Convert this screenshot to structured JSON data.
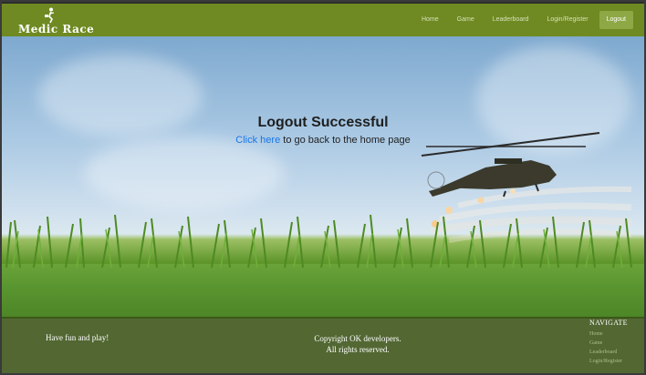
{
  "navbar": {
    "logo_text": "Medic Race",
    "links": [
      {
        "label": "Home"
      },
      {
        "label": "Game"
      },
      {
        "label": "Leaderboard"
      },
      {
        "label": "Login/Register"
      },
      {
        "label": "Logout"
      }
    ],
    "active_index": 4,
    "color": "#6f8a22"
  },
  "hero": {
    "title": "Logout Successful",
    "link_text": "Click here",
    "rest_text": " to go back to the home page",
    "link_color": "#1976e8"
  },
  "footer": {
    "left_text": "Have fun and play!",
    "copyright_line1": "Copyright OK developers.",
    "copyright_line2": "All rights reserved.",
    "nav_title": "NAVIGATE",
    "nav_items": [
      "Home",
      "Game",
      "Leaderboard",
      "Login/Register"
    ]
  }
}
